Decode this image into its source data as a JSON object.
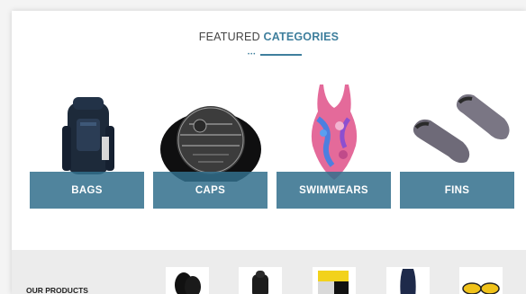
{
  "section": {
    "title_plain": "FEATURED ",
    "title_accent": "CATEGORIES"
  },
  "categories": [
    {
      "label": "BAGS",
      "icon": "backpack-image"
    },
    {
      "label": "CAPS",
      "icon": "swim-cap-image"
    },
    {
      "label": "SWIMWEARS",
      "icon": "swimsuit-image"
    },
    {
      "label": "FINS",
      "icon": "fins-image"
    }
  ],
  "products": {
    "label": "OUR PRODUCTS",
    "items": [
      "flip-flops-image",
      "backpack-image",
      "mesh-bag-image",
      "swimsuit-image",
      "goggles-image"
    ]
  },
  "colors": {
    "accent": "#3f7f9d",
    "banner": "#316e8c"
  }
}
